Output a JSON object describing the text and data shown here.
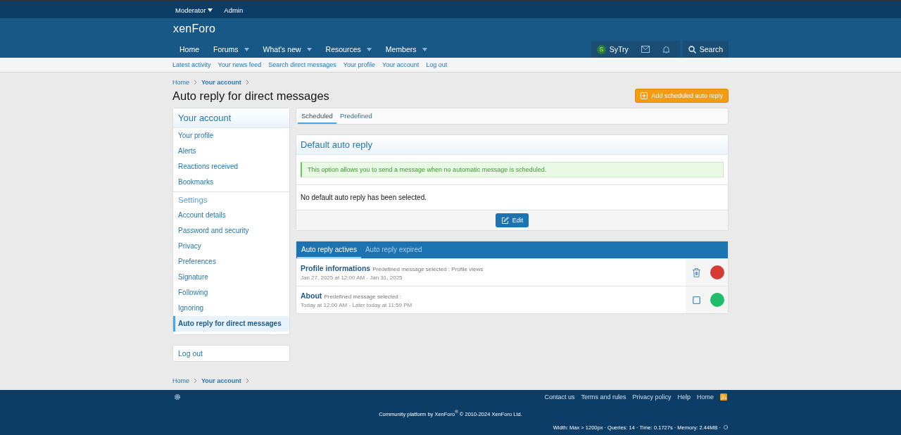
{
  "staff_bar": [
    {
      "label": "Moderator",
      "dropdown": true
    },
    {
      "label": "Admin",
      "dropdown": false
    }
  ],
  "logo": "xenForo",
  "nav": [
    {
      "label": "Home",
      "dropdown": false
    },
    {
      "label": "Forums",
      "dropdown": true
    },
    {
      "label": "What's new",
      "dropdown": true
    },
    {
      "label": "Resources",
      "dropdown": true
    },
    {
      "label": "Members",
      "dropdown": true
    }
  ],
  "user": {
    "avatar_letter": "S",
    "name": "SyTry",
    "search": "Search"
  },
  "subnav": [
    "Latest activity",
    "Your news feed",
    "Search direct messages",
    "Your profile",
    "Your account",
    "Log out"
  ],
  "breadcrumb": [
    {
      "label": "Home",
      "current": false
    },
    {
      "label": "Your account",
      "current": true
    }
  ],
  "footer_breadcrumb": [
    {
      "label": "Home",
      "current": false
    },
    {
      "label": "Your account",
      "current": true
    }
  ],
  "title": "Auto reply for direct messages",
  "add_button": "Add scheduled auto reply",
  "sidebar": {
    "heading": "Your account",
    "items": [
      {
        "label": "Your profile",
        "kind": "link",
        "selected": false
      },
      {
        "label": "Alerts",
        "kind": "link",
        "selected": false
      },
      {
        "label": "Reactions received",
        "kind": "link",
        "selected": false
      },
      {
        "label": "Bookmarks",
        "kind": "link",
        "selected": false
      },
      {
        "label": "Settings",
        "kind": "heading"
      },
      {
        "label": "Account details",
        "kind": "link",
        "selected": false
      },
      {
        "label": "Password and security",
        "kind": "link",
        "selected": false
      },
      {
        "label": "Privacy",
        "kind": "link",
        "selected": false
      },
      {
        "label": "Preferences",
        "kind": "link",
        "selected": false
      },
      {
        "label": "Signature",
        "kind": "link",
        "selected": false
      },
      {
        "label": "Following",
        "kind": "link",
        "selected": false
      },
      {
        "label": "Ignoring",
        "kind": "link",
        "selected": false
      },
      {
        "label": "Auto reply for direct messages",
        "kind": "link",
        "selected": true
      }
    ],
    "logout": "Log out"
  },
  "tabs": [
    {
      "label": "Scheduled",
      "selected": true
    },
    {
      "label": "Predefined",
      "selected": false
    }
  ],
  "default_block": {
    "title": "Default auto reply",
    "notice": "This option allows you to send a message when no automatic message is scheduled.",
    "message": "No default auto reply has been selected.",
    "button": "Edit"
  },
  "list_tabs": [
    {
      "label": "Auto reply actives",
      "selected": true
    },
    {
      "label": "Auto reply expired",
      "selected": false
    }
  ],
  "rows": [
    {
      "title": "Profile informations",
      "detail": "Predefined message selected : Profile views",
      "dates": "Jan 27, 2025 at 12:00 AM - Jan 31, 2025",
      "kind": "trash",
      "color": "#d63a32"
    },
    {
      "title": "About",
      "detail": "Predefined message selected :",
      "dates": "Today at 12:00 AM - Later today at 11:59 PM",
      "kind": "checkbox",
      "checked": false,
      "color": "#1ebd6a"
    }
  ],
  "footer": {
    "links": [
      "Contact us",
      "Terms and rules",
      "Privacy policy",
      "Help",
      "Home"
    ],
    "copyright": "Community platform by XenForo$^{®}$ © 2010-2024 XenForo Ltd.",
    "debug": "Width: Max > 1200px · Queries: 14 · Time: 0.1727s · Memory: 2.44MB ·"
  }
}
